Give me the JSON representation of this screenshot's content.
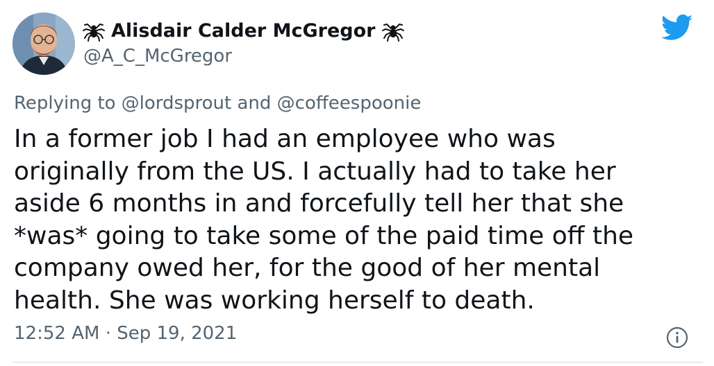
{
  "tweet": {
    "author": {
      "display_name": "Alisdair Calder McGregor",
      "handle": "@A_C_McGregor",
      "name_decoration_icon": "spider-icon"
    },
    "replying_to": {
      "prefix": "Replying to",
      "mention_1": "@lordsprout",
      "conjunction": "and",
      "mention_2": "@coffeespoonie"
    },
    "text": "In a former job I had an employee who was\noriginally from the US. I actually had to take her\naside 6 months in and forcefully tell her that she\n*was* going to take some of the paid time off the\ncompany owed her, for the good of her mental\nhealth. She was working herself to death.",
    "timestamp": {
      "time": "12:52 AM",
      "separator": "·",
      "date": "Sep 19, 2021"
    },
    "icons": {
      "brand": "twitter-bird-icon",
      "info": "info-icon"
    }
  },
  "colors": {
    "brand": "#1d9bf0",
    "text_primary": "#0f1419",
    "text_secondary": "#536471",
    "divider": "#cfd9de"
  }
}
